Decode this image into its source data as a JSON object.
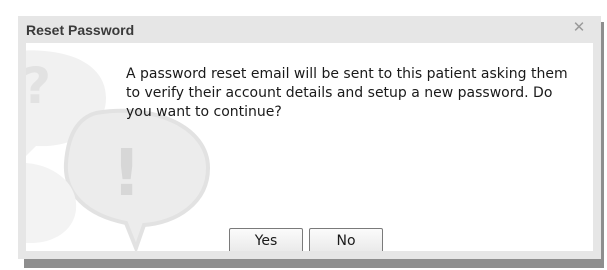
{
  "dialog": {
    "title": "Reset Password",
    "close_icon": "close-icon",
    "message": "A password reset email will be sent to this patient asking them to verify their account details and setup a new password. Do you want to continue?",
    "buttons": {
      "yes_label": "Yes",
      "no_label": "No"
    },
    "watermark_icon": "question-exclamation-bubbles-icon"
  },
  "colors": {
    "title_bar": "#e6e6e6",
    "content_bg": "#ffffff",
    "shadow": "#8e8e8e",
    "close_glyph": "#9a9a9a"
  }
}
